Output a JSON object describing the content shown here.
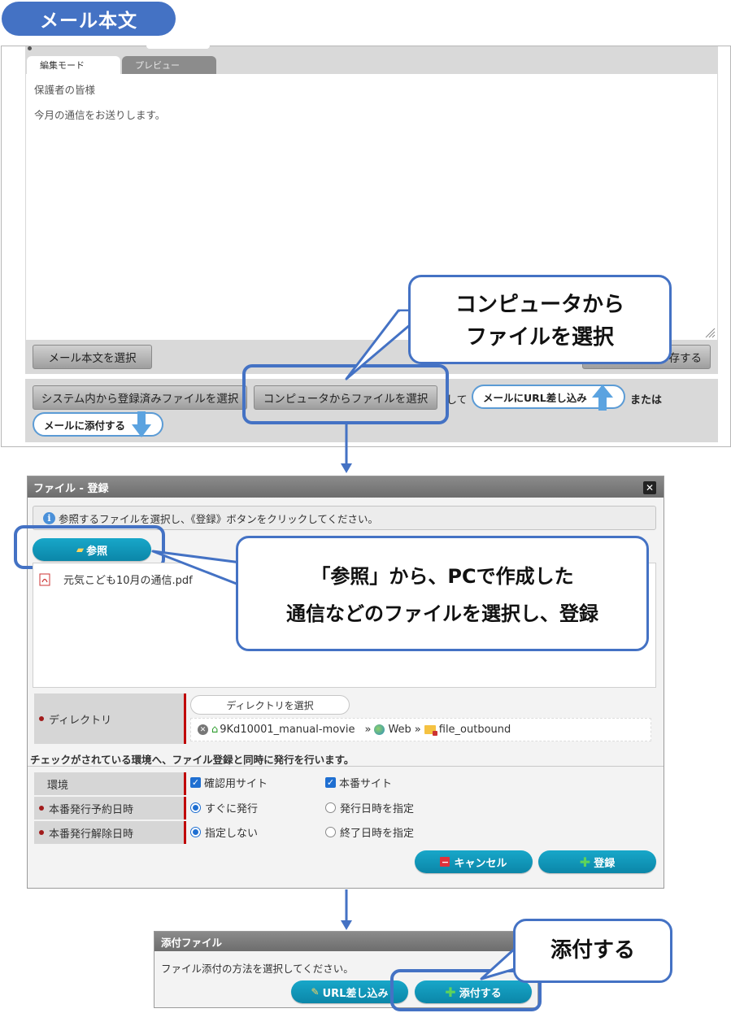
{
  "header": {
    "title": "メール本文"
  },
  "editor": {
    "tabs": [
      {
        "label": "編集モード",
        "active": true
      },
      {
        "label": "プレビュー",
        "active": false
      }
    ],
    "body_lines": [
      "保護者の皆様",
      "今月の通信をお送りします。"
    ],
    "select_body_button": "メール本文を選択",
    "save_button_partial": "存する",
    "attach_row": {
      "system_file_button": "システム内から登録済みファイルを選択",
      "computer_file_button": "コンピュータからファイルを選択",
      "connector_shite": "して",
      "url_insert_button": "メールにURL差し込み",
      "or_text": "または",
      "attach_to_mail_button": "メールに添付する"
    }
  },
  "callouts": {
    "computer_select": [
      "コンピュータから",
      "ファイルを選択"
    ],
    "browse_register": [
      "「参照」から、PCで作成した",
      "通信などのファイルを選択し、登録"
    ],
    "attach": "添付する"
  },
  "file_dialog": {
    "title": "ファイル - 登録",
    "info": "参照するファイルを選択し、《登録》ボタンをクリックしてください。",
    "browse_button": "参照",
    "files": [
      "元気こども10月の通信.pdf"
    ],
    "directory": {
      "label": "ディレクトリ",
      "select_button": "ディレクトリを選択",
      "path": [
        "9Kd10001_manual-movie",
        "Web",
        "file_outbound"
      ],
      "separator": "»"
    },
    "publish_note": "チェックがされている環境へ、ファイル登録と同時に発行を行います。",
    "environment": {
      "label": "環境",
      "options": [
        {
          "label": "確認用サイト",
          "checked": true
        },
        {
          "label": "本番サイト",
          "checked": true
        }
      ]
    },
    "publish_schedule": {
      "label": "本番発行予約日時",
      "options": [
        {
          "label": "すぐに発行",
          "selected": true
        },
        {
          "label": "発行日時を指定",
          "selected": false
        }
      ]
    },
    "unpublish_schedule": {
      "label": "本番発行解除日時",
      "options": [
        {
          "label": "指定しない",
          "selected": true
        },
        {
          "label": "終了日時を指定",
          "selected": false
        }
      ]
    },
    "cancel_button": "キャンセル",
    "register_button": "登録"
  },
  "attach_panel": {
    "title": "添付ファイル",
    "instruction": "ファイル添付の方法を選択してください。",
    "url_insert_button": "URL差し込み",
    "attach_button": "添付する"
  },
  "colors": {
    "accent_blue": "#4472c4",
    "teal": "#0b86a8",
    "required_red": "#c00000",
    "cancel_red": "#e0323c",
    "plus_green": "#3cb043"
  }
}
